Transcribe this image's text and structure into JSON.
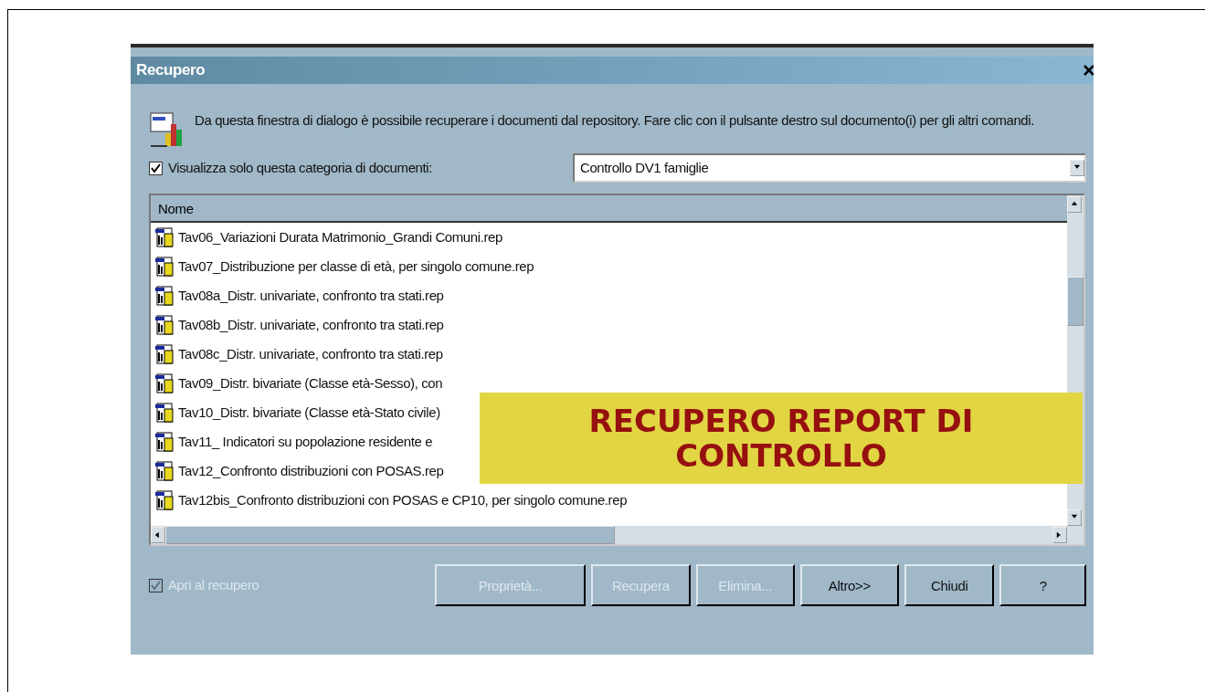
{
  "window": {
    "title": "Recupero"
  },
  "description": "Da questa finestra di dialogo è possibile recuperare i documenti dal repository. Fare clic con il pulsante destro sul documento(i) per gli altri comandi.",
  "category_filter": {
    "label": "Visualizza solo questa categoria di documenti:",
    "checked": true,
    "value": "Controllo DV1 famiglie"
  },
  "list": {
    "columns": [
      "Nome"
    ],
    "rows": [
      {
        "name": "Tav06_Variazioni Durata Matrimonio_Grandi Comuni.rep"
      },
      {
        "name": "Tav07_Distribuzione per classe di età, per singolo comune.rep"
      },
      {
        "name": "Tav08a_Distr. univariate, confronto tra stati.rep"
      },
      {
        "name": "Tav08b_Distr. univariate, confronto tra stati.rep"
      },
      {
        "name": "Tav08c_Distr. univariate, confronto tra stati.rep"
      },
      {
        "name": "Tav09_Distr. bivariate (Classe età-Sesso), con"
      },
      {
        "name": "Tav10_Distr. bivariate (Classe età-Stato civile)"
      },
      {
        "name": "Tav11_ Indicatori su popolazione residente e"
      },
      {
        "name": "Tav12_Confronto distribuzioni con POSAS.rep"
      },
      {
        "name": "Tav12bis_Confronto distribuzioni con POSAS e CP10, per singolo comune.rep"
      }
    ]
  },
  "open_on_retrieve": {
    "label": "Apri al recupero",
    "checked": true,
    "disabled": true
  },
  "buttons": [
    {
      "label": "Proprietà...",
      "disabled": true
    },
    {
      "label": "Recupera",
      "disabled": true
    },
    {
      "label": "Elimina...",
      "disabled": true
    },
    {
      "label": "Altro>>",
      "disabled": false
    },
    {
      "label": "Chiudi",
      "disabled": false
    },
    {
      "label": "?",
      "disabled": false
    }
  ],
  "caption": "RECUPERO REPORT DI CONTROLLO"
}
